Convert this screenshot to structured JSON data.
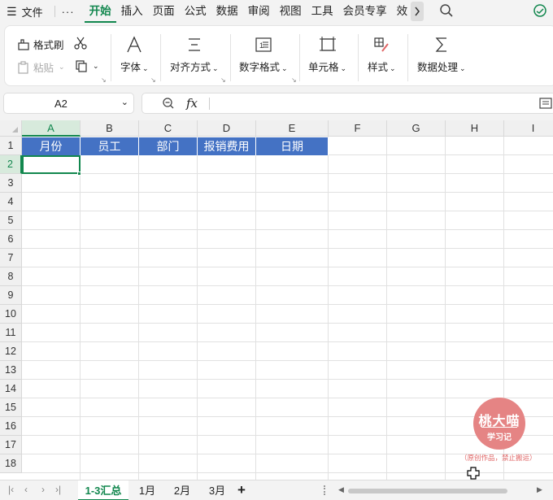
{
  "menubar": {
    "file_label": "文件",
    "more_label": "···",
    "tabs": [
      "开始",
      "插入",
      "页面",
      "公式",
      "数据",
      "审阅",
      "视图",
      "工具",
      "会员专享",
      "效"
    ],
    "active_tab": "开始"
  },
  "ribbon": {
    "format_painter": "格式刷",
    "paste": "粘贴",
    "font": "字体",
    "align": "对齐方式",
    "number_format": "数字格式",
    "cell": "单元格",
    "style": "样式",
    "data_process": "数据处理"
  },
  "formula_bar": {
    "name_box": "A2",
    "fx": "fx",
    "formula_value": ""
  },
  "grid": {
    "columns": [
      "A",
      "B",
      "C",
      "D",
      "E",
      "F",
      "G",
      "H",
      "I"
    ],
    "rows": [
      "1",
      "2",
      "3",
      "4",
      "5",
      "6",
      "7",
      "8",
      "9",
      "10",
      "11",
      "12",
      "13",
      "14",
      "15",
      "16",
      "17",
      "18"
    ],
    "selected_column": "A",
    "selected_row": "2",
    "header_row": [
      "月份",
      "员工",
      "部门",
      "报销费用",
      "日期"
    ],
    "header_fill": "#4472c4",
    "accent": "#12874e"
  },
  "watermark": {
    "title": "桃大喵",
    "subtitle": "学习记",
    "note": "（原创作品，禁止搬运）"
  },
  "sheets": {
    "tabs": [
      "1-3汇总",
      "1月",
      "2月",
      "3月"
    ],
    "active": "1-3汇总",
    "add_label": "+"
  }
}
